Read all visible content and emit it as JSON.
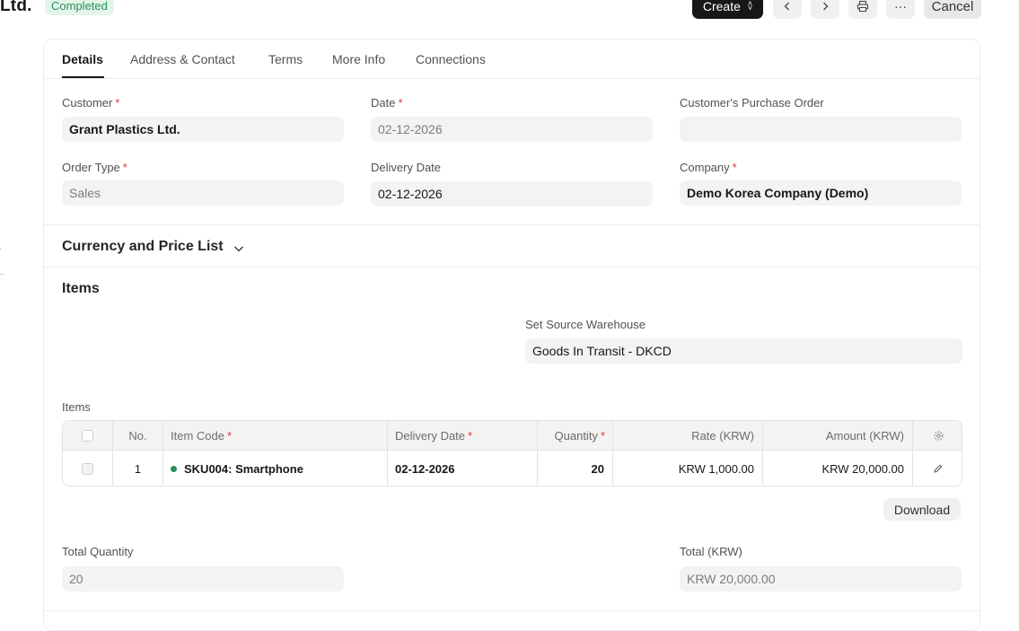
{
  "header": {
    "title": "Ltd.",
    "status_badge": "Completed",
    "create_label": "Create",
    "prev_icon": "chevron-left-icon",
    "next_icon": "chevron-right-icon",
    "print_icon": "printer-icon",
    "more_label": "···",
    "cancel_label": "Cancel"
  },
  "tabs": [
    {
      "label": "Details",
      "active": true
    },
    {
      "label": "Address & Contact"
    },
    {
      "label": "Terms"
    },
    {
      "label": "More Info"
    },
    {
      "label": "Connections"
    }
  ],
  "fields": {
    "customer": {
      "label": "Customer",
      "value": "Grant Plastics Ltd."
    },
    "date": {
      "label": "Date",
      "value": "02-12-2026"
    },
    "customer_po": {
      "label": "Customer's Purchase Order",
      "value": ""
    },
    "order_type": {
      "label": "Order Type",
      "value": "Sales"
    },
    "delivery_date": {
      "label": "Delivery Date",
      "value": "02-12-2026"
    },
    "company": {
      "label": "Company",
      "value": "Demo Korea Company (Demo)"
    }
  },
  "currency_section": {
    "title": "Currency and Price List"
  },
  "items_section": {
    "title": "Items",
    "source_warehouse": {
      "label": "Set Source Warehouse",
      "value": "Goods In Transit - DKCD"
    },
    "table_label": "Items",
    "columns": {
      "no": "No.",
      "item_code": "Item Code",
      "delivery_date": "Delivery Date",
      "quantity": "Quantity",
      "rate": "Rate (KRW)",
      "amount": "Amount (KRW)"
    },
    "rows": [
      {
        "no": "1",
        "item_code": "SKU004: Smartphone",
        "delivery_date": "02-12-2026",
        "quantity": "20",
        "rate": "KRW 1,000.00",
        "amount": "KRW 20,000.00"
      }
    ],
    "download_label": "Download"
  },
  "totals": {
    "total_quantity": {
      "label": "Total Quantity",
      "value": "20"
    },
    "total": {
      "label": "Total (KRW)",
      "value": "KRW 20,000.00"
    }
  },
  "colors": {
    "accent": "#171717",
    "status_green": "#278f5e",
    "required": "#e03636"
  }
}
